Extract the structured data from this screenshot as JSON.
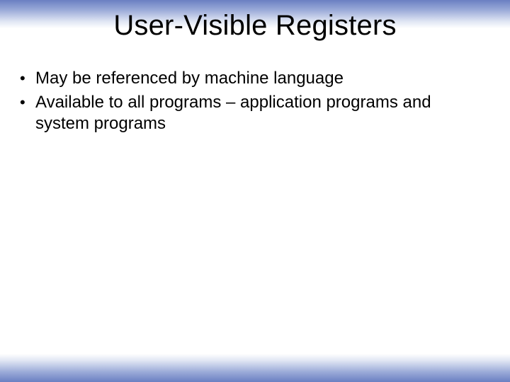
{
  "title": "User-Visible Registers",
  "bullets": [
    "May be referenced by machine language",
    "Available to all programs – application programs and system programs"
  ]
}
